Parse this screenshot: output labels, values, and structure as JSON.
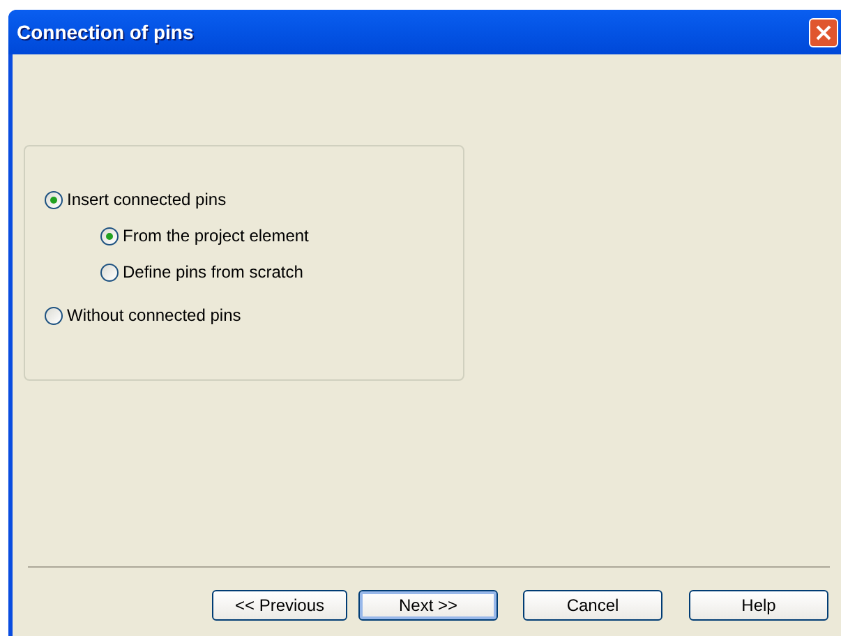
{
  "window": {
    "title": "Connection of pins"
  },
  "options": [
    {
      "label": "Insert connected pins",
      "selected": true,
      "children": [
        {
          "label": "From the project element",
          "selected": true
        },
        {
          "label": "Define pins from scratch",
          "selected": false
        }
      ]
    },
    {
      "label": "Without connected pins",
      "selected": false
    }
  ],
  "buttons": [
    {
      "label": "<< Previous",
      "default": false
    },
    {
      "label": "Next >>",
      "default": true
    },
    {
      "label": "Cancel",
      "default": false
    },
    {
      "label": "Help",
      "default": false
    }
  ]
}
